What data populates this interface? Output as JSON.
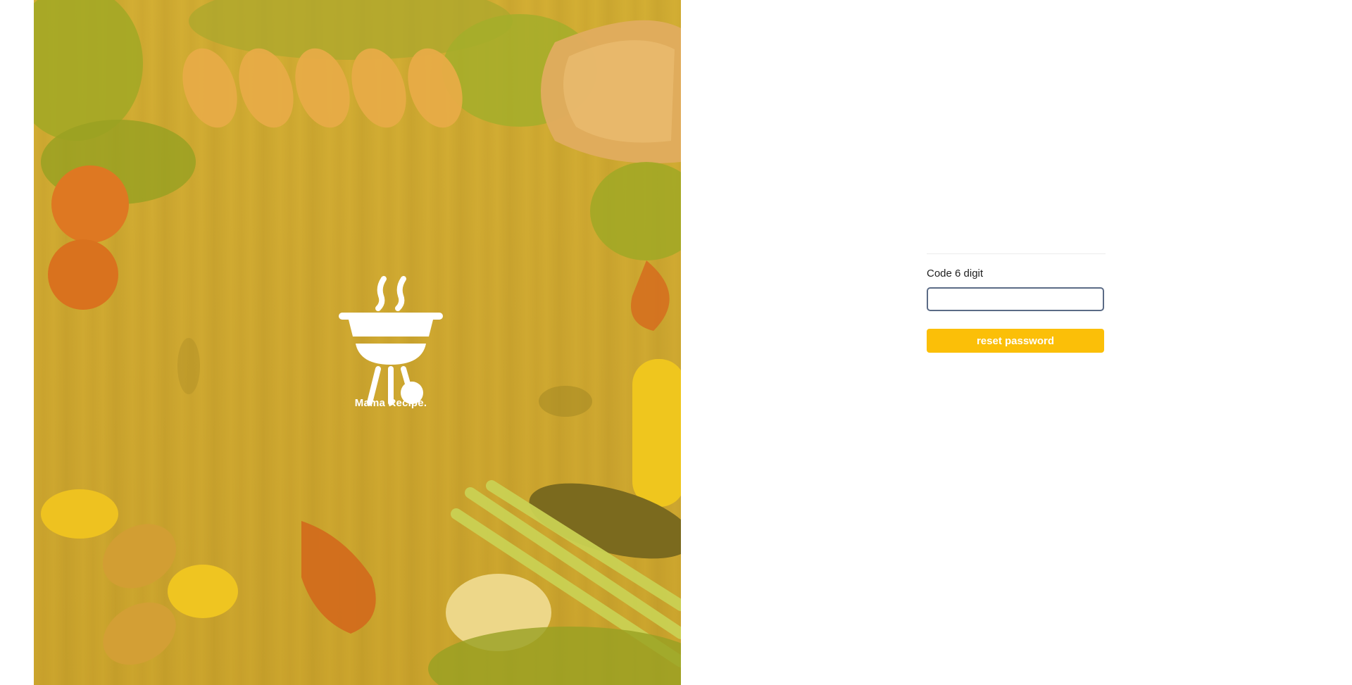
{
  "brand": {
    "name": "Mama Recipe.",
    "logo_icon": "grill-icon"
  },
  "hero": {
    "background": "food-on-wood-table-photo",
    "overlay_color": "#EBC428"
  },
  "reset_form": {
    "code_label": "Code 6 digit",
    "code_value": "",
    "code_placeholder": "",
    "submit_label": "reset password",
    "accent_color": "#FBBF08",
    "input_border_color": "#5B6B86"
  }
}
